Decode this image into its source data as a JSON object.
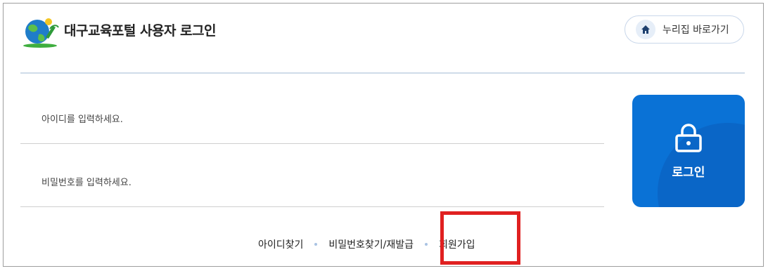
{
  "header": {
    "title": "대구교육포털 사용자 로그인",
    "home_button_label": "누리집 바로가기"
  },
  "form": {
    "id_placeholder": "아이디를 입력하세요.",
    "password_placeholder": "비밀번호를 입력하세요.",
    "login_label": "로그인"
  },
  "links": {
    "find_id": "아이디찾기",
    "find_password": "비밀번호찾기/재발급",
    "signup": "회원가입"
  },
  "colors": {
    "accent": "#0a72d6",
    "highlight": "#e02020"
  },
  "icons": {
    "logo": "globe-logo-icon",
    "home": "home-icon",
    "login": "lock-icon"
  }
}
